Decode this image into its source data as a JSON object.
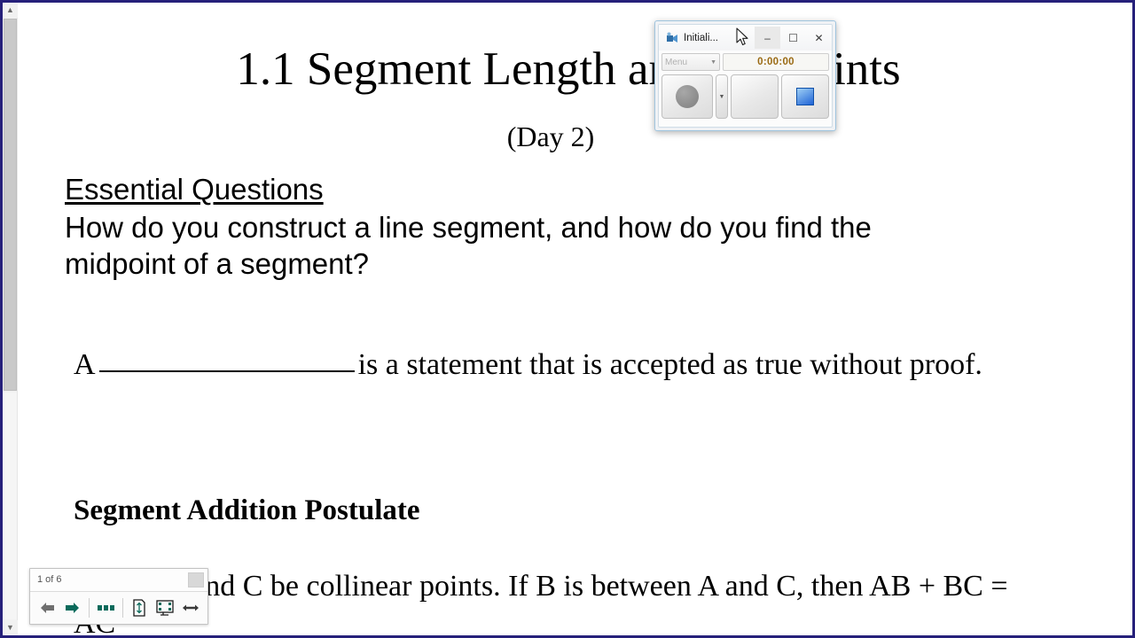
{
  "window": {
    "border_color": "#26207a",
    "background": "#ffffff"
  },
  "scrollbar": {
    "up_arrow": "▲",
    "down_arrow": "▼"
  },
  "slide": {
    "title": "1.1 Segment Length and Midpoints",
    "subtitle": "(Day 2)",
    "essential_questions_heading": "Essential Questions",
    "essential_questions_body": "How do you construct a line segment, and how do you find the midpoint of a segment?",
    "axiom_prefix": "A",
    "axiom_suffix": "is a statement that is accepted as true without proof.",
    "postulate_heading": "Segment Addition Postulate",
    "postulate_body": "Let A, B, and C be collinear points. If B is between A and C, then AB + BC = AC"
  },
  "page_nav": {
    "page_indicator": "1 of 6",
    "buttons": [
      {
        "name": "previous-page",
        "glyph": "←",
        "color": "#6f6f6f"
      },
      {
        "name": "next-page",
        "glyph": "→",
        "color": "#0b6a5b"
      },
      {
        "name": "thumbnails",
        "glyph": "▬▬▬",
        "color": "#0b6a5b"
      },
      {
        "name": "fit-page",
        "glyph": "↕",
        "color": "#0b6a5b"
      },
      {
        "name": "fit-screen",
        "glyph": "⬚",
        "color": "#0b6a5b"
      },
      {
        "name": "fit-width",
        "glyph": "↔",
        "color": "#3a3a3a"
      }
    ]
  },
  "recorder": {
    "title": "Initiali...",
    "minimize_label": "–",
    "maximize_label": "☐",
    "close_label": "✕",
    "menu_label": "Menu",
    "menu_caret": "▼",
    "timer": "0:00:00",
    "record_dropdown_caret": "▼",
    "accent_color": "#9fc4de",
    "timer_color": "#9a6a13",
    "stop_color": "#1f63d6"
  }
}
